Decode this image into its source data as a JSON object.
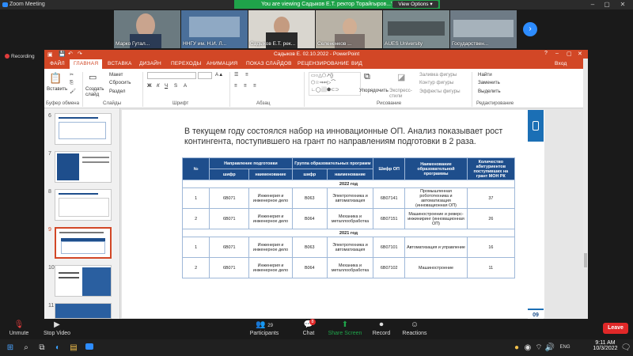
{
  "zoom": {
    "title": "Zoom Meeting",
    "banner": "You are viewing Садыков Е.Т. ректор Торайгыров...'s screen",
    "view_options": "View Options ▾",
    "recording": "Recording",
    "participants_named": [
      "Марко Гутал...",
      "ННГУ им. Н.И. Л...",
      "Садыков Е.Т. рек...",
      "Селененков ...",
      "AUES University",
      "Государствен..."
    ],
    "toolbar": {
      "unmute": "Unmute",
      "stop_video": "Stop Video",
      "participants": "Participants",
      "participants_count": "29",
      "chat": "Chat",
      "chat_badge": "8",
      "share_screen": "Share Screen",
      "record": "Record",
      "reactions": "Reactions",
      "leave": "Leave"
    }
  },
  "ppt": {
    "window_title": "Садыков Е. 02.10.2022 - PowerPoint",
    "login": "Вход",
    "tabs": [
      "ФАЙЛ",
      "ГЛАВНАЯ",
      "ВСТАВКА",
      "ДИЗАЙН",
      "ПЕРЕХОДЫ",
      "АНИМАЦИЯ",
      "ПОКАЗ СЛАЙДОВ",
      "РЕЦЕНЗИРОВАНИЕ",
      "ВИД"
    ],
    "ribbon": {
      "paste": "Вставить",
      "clipboard_group": "Буфер обмена",
      "create_slide": "Создать слайд",
      "layout": "Макет",
      "reset": "Сбросить",
      "section": "Раздел",
      "slides_group": "Слайды",
      "font_group": "Шрифт",
      "paragraph_group": "Абзац",
      "arrange": "Упорядочить",
      "express_styles": "Экспресс-стили",
      "shape_fill": "Заливка фигуры",
      "shape_outline": "Контур фигуры",
      "shape_effects": "Эффекты фигуры",
      "drawing_group": "Рисование",
      "find": "Найти",
      "replace": "Заменить",
      "select": "Выделить",
      "editing_group": "Редактирование"
    },
    "slide_numbers": [
      "6",
      "7",
      "8",
      "9",
      "10",
      "11"
    ]
  },
  "slide": {
    "heading": "В текущем году состоялся набор на инновационные ОП. Анализ показывает рост контингента, поступившего на грант по направлениям подготовки в 2 раза.",
    "page": "09",
    "table": {
      "h_num": "№",
      "h_direction": "Направление подготовки",
      "h_group": "Группа образовательных программ",
      "h_code_op": "Шифр ОП",
      "h_name_op": "Наименование образовательной программы",
      "h_count": "Количество абитуриентов поступивших на грант МОН РК",
      "h_code": "шифр",
      "h_name": "наименование",
      "year_2022": "2022 год",
      "year_2021": "2021 год",
      "rows": [
        {
          "n": "1",
          "dcode": "6В071",
          "dname": "Инженерия и инженерное дело",
          "gcode": "В063",
          "gname": "Электротехника и автоматизация",
          "op": "6В07141",
          "opname": "Промышленная робототехника и автоматизация (инновационная ОП)",
          "count": "37"
        },
        {
          "n": "2",
          "dcode": "6В071",
          "dname": "Инженерия и инженерное дело",
          "gcode": "В064",
          "gname": "Механика и металлообработка",
          "op": "6В07151",
          "opname": "Машиностроение и реверс-инжиниринг (инновационная ОП)",
          "count": "26"
        },
        {
          "n": "1",
          "dcode": "6В071",
          "dname": "Инженерия и инженерное дело",
          "gcode": "В063",
          "gname": "Электротехника и автоматизация",
          "op": "6В07101",
          "opname": "Автоматизация и управление",
          "count": "16"
        },
        {
          "n": "2",
          "dcode": "6В071",
          "dname": "Инженерия и инженерное дело",
          "gcode": "В064",
          "gname": "Механика и металлообработка",
          "op": "6В07102",
          "opname": "Машиностроение",
          "count": "11"
        }
      ]
    }
  },
  "taskbar": {
    "time": "9:11 AM",
    "date": "10/3/2022",
    "lang": "ENG"
  }
}
